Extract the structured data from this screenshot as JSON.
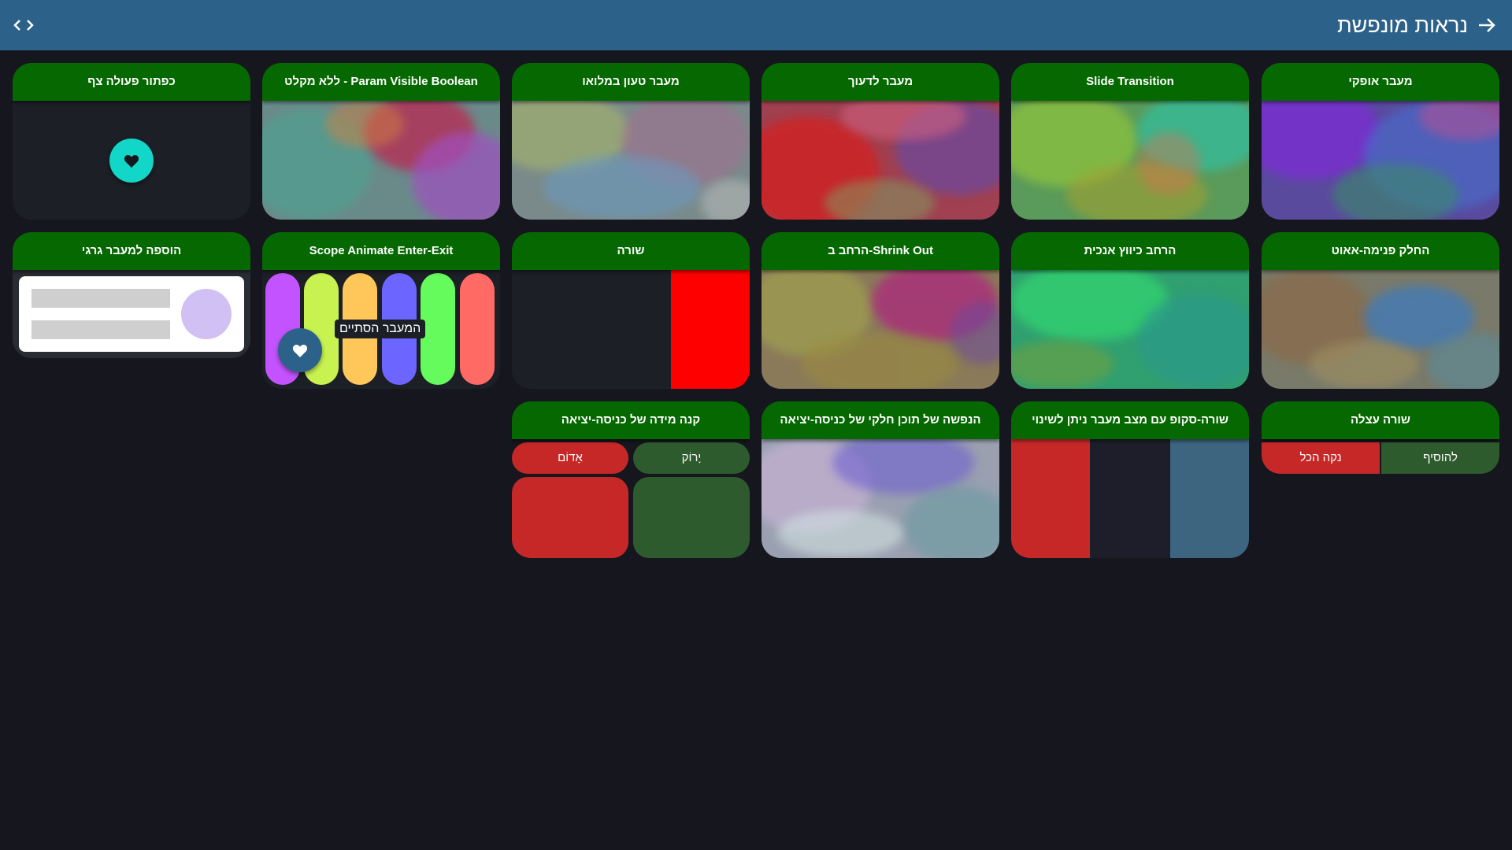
{
  "topbar": {
    "title": "נראות מונפשת",
    "back_icon": "arrow-forward-icon",
    "code_icon": "code-icon"
  },
  "cards": {
    "horizontal_transition": {
      "title": "מעבר אופקי"
    },
    "slide_transition": {
      "title": "Slide Transition"
    },
    "fade_transition": {
      "title": "מעבר לדעוך"
    },
    "fully_loaded_transition": {
      "title": "מעבר טעון במלואו"
    },
    "param_visible_boolean": {
      "title": "Param Visible Boolean - ללא מקלט"
    },
    "fab_action": {
      "title": "כפתור פעולה צף"
    },
    "slide_in_out": {
      "title": "החלק פנימה-אאוט"
    },
    "expand_vertical": {
      "title": "הרחב כיווץ אנכית"
    },
    "shrink_out": {
      "title": "Shrink Out-הרחב ב"
    },
    "row": {
      "title": "שורה"
    },
    "scope_animate": {
      "title": "Scope Animate Enter-Exit",
      "hidden_label": "המעבר הסתיים"
    },
    "shared_transition": {
      "title": "הוספה למעבר גרגי"
    },
    "lazy_row": {
      "title": "שורה עצלה",
      "add_button": "להוסיף",
      "clear_button": "נקה הכל"
    },
    "row_scope": {
      "title": "שורה-סקופ עם מצב מעבר ניתן לשינוי"
    },
    "partial_content": {
      "title": "הנפשה של תוכן חלקי של כניסה-יציאה"
    },
    "size_enter_exit": {
      "title": "קנה מידה של כניסה-יציאה",
      "green_button": "יָרוֹק",
      "red_button": "אָדוֹם"
    }
  },
  "colors": {
    "topbar": "#2c6289",
    "header_green": "#056800",
    "background": "#16161e",
    "fab_teal": "#12d6c8",
    "red": "#ff0000",
    "button_red": "#c62828",
    "button_green": "#2e5b2e",
    "stripes": [
      "#c353ff",
      "#c8f24f",
      "#ffc75a",
      "#6d65ff",
      "#65fb5c",
      "#ff6a64"
    ]
  }
}
